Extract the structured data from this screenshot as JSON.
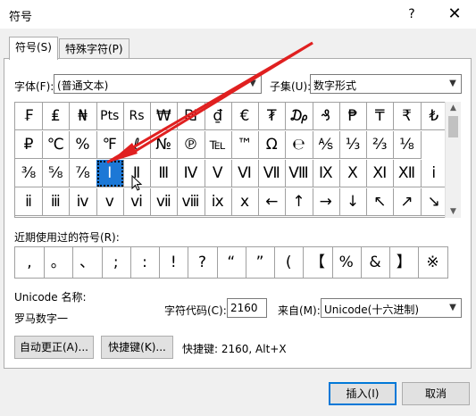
{
  "window": {
    "title": "符号",
    "help": "?",
    "close": "✕"
  },
  "tabs": [
    {
      "label": "符号(S)"
    },
    {
      "label": "特殊字符(P)"
    }
  ],
  "font": {
    "label": "字体(F):",
    "value": "(普通文本)"
  },
  "subset": {
    "label": "子集(U):",
    "value": "数字形式"
  },
  "symbols": [
    [
      "₣",
      "₤",
      "₦",
      "Pts",
      "Rs",
      "₩",
      "₪",
      "₫",
      "€",
      "₮",
      "₯",
      "₰",
      "₱",
      "₸",
      "₹",
      "₺"
    ],
    [
      "₽",
      "℃",
      "%",
      "℉",
      "ℓ",
      "№",
      "℗",
      "℡",
      "™",
      "Ω",
      "℮",
      "⅍",
      "⅓",
      "⅔",
      "⅛"
    ],
    [
      "⅜",
      "⅝",
      "⅞",
      "Ⅰ",
      "Ⅱ",
      "Ⅲ",
      "Ⅳ",
      "Ⅴ",
      "Ⅵ",
      "Ⅶ",
      "Ⅷ",
      "Ⅸ",
      "Ⅹ",
      "Ⅺ",
      "Ⅻ",
      "ⅰ"
    ],
    [
      "ⅱ",
      "ⅲ",
      "ⅳ",
      "ⅴ",
      "ⅵ",
      "ⅶ",
      "ⅷ",
      "ⅸ",
      "ⅹ",
      "←",
      "↑",
      "→",
      "↓",
      "↖",
      "↗",
      "↘"
    ]
  ],
  "selected_symbol": "Ⅰ",
  "recent": {
    "label": "近期使用过的符号(R):",
    "items": [
      ",",
      "。",
      "、",
      ";",
      ":",
      "!",
      "?",
      "“",
      "”",
      "(",
      "【",
      "%",
      "&",
      "】",
      "※"
    ]
  },
  "unicode_name": {
    "label": "Unicode 名称:",
    "value": "罗马数字一"
  },
  "char_code": {
    "label": "字符代码(C):",
    "value": "2160"
  },
  "from": {
    "label": "来自(M):",
    "value": "Unicode(十六进制)"
  },
  "buttons": {
    "autocorrect": "自动更正(A)...",
    "shortcut_key": "快捷键(K)...",
    "shortcut_text": "快捷键: 2160, Alt+X",
    "insert": "插入(I)",
    "cancel": "取消"
  },
  "annotation_color": "#e02020"
}
